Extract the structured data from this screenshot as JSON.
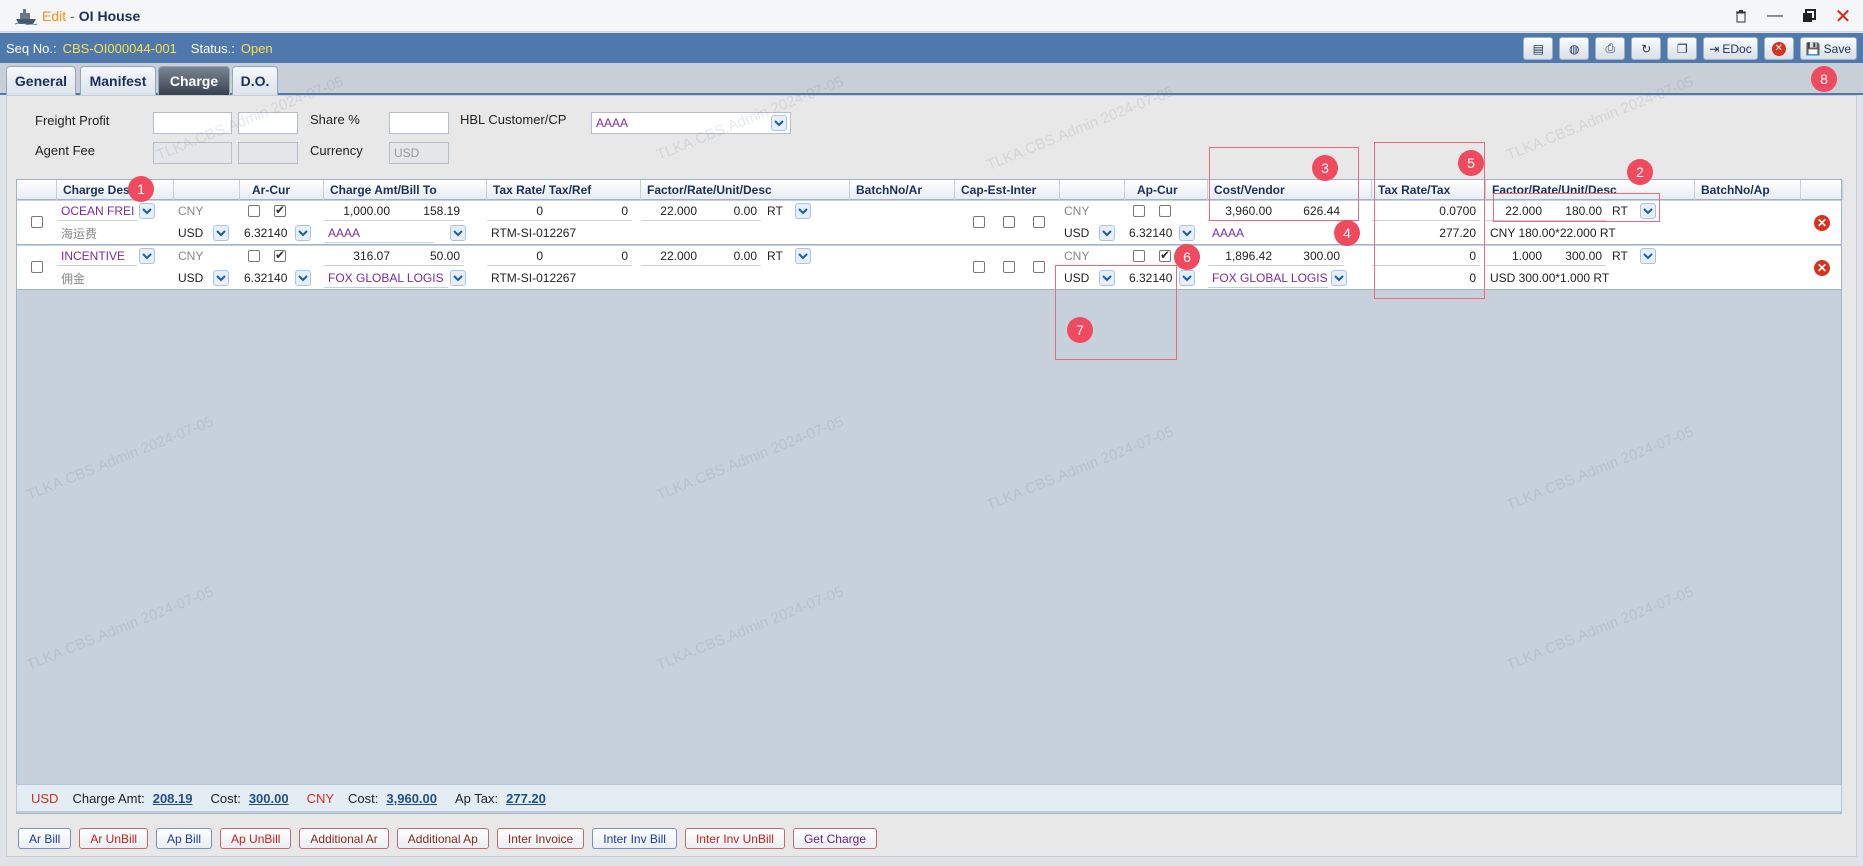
{
  "window": {
    "edit_label": "Edit",
    "separator": "-",
    "title": "OI House"
  },
  "info": {
    "seq_label": "Seq No.:",
    "seq_value": "CBS-OI000044-001",
    "status_label": "Status.:",
    "status_value": "Open"
  },
  "toolbar": {
    "edoc_label": "EDoc",
    "save_label": "Save"
  },
  "tabs": [
    {
      "label": "General"
    },
    {
      "label": "Manifest"
    },
    {
      "label": "Charge"
    },
    {
      "label": "D.O."
    }
  ],
  "form": {
    "freight_profit_label": "Freight Profit",
    "share_label": "Share %",
    "hbl_customer_label": "HBL Customer/CP",
    "hbl_customer_value": "AAAA",
    "agent_fee_label": "Agent Fee",
    "currency_label": "Currency",
    "currency_value": "USD"
  },
  "grid": {
    "headers": [
      "Charge Desc",
      "Ar-Cur",
      "Charge Amt/Bill To",
      "Tax Rate/ Tax/Ref",
      "Factor/Rate/Unit/Desc",
      "BatchNo/Ar",
      "Cap-Est-Inter",
      "Ap-Cur",
      "Cost/Vendor",
      "Tax Rate/Tax",
      "Factor/Rate/Unit/Desc",
      "BatchNo/Ap"
    ],
    "rows": [
      {
        "charge": "OCEAN FREI",
        "charge_cn": "海运费",
        "ar_cur": "CNY",
        "ar_cur2": "USD",
        "ar_rate": "6.32140",
        "amt1": "1,000.00",
        "amt2": "158.19",
        "bill_to": "AAAA",
        "tax1": "0",
        "tax2": "0",
        "tax_ref": "RTM-SI-012267",
        "factor": "22.000",
        "rate": "0.00",
        "unit": "RT",
        "ap_cur": "CNY",
        "ap_cur2": "USD",
        "ap_rate": "6.32140",
        "cost1": "3,960.00",
        "cost2": "626.44",
        "vendor": "AAAA",
        "ap_tax_rate": "0.0700",
        "ap_tax": "277.20",
        "ap_factor": "22.000",
        "ap_rate_val": "180.00",
        "ap_unit": "RT",
        "ap_desc": "CNY 180.00*22.000 RT"
      },
      {
        "charge": "INCENTIVE",
        "charge_cn": "佣金",
        "ar_cur": "CNY",
        "ar_cur2": "USD",
        "ar_rate": "6.32140",
        "amt1": "316.07",
        "amt2": "50.00",
        "bill_to": "FOX GLOBAL LOGIS",
        "tax1": "0",
        "tax2": "0",
        "tax_ref": "RTM-SI-012267",
        "factor": "22.000",
        "rate": "0.00",
        "unit": "RT",
        "ap_cur": "CNY",
        "ap_cur2": "USD",
        "ap_rate": "6.32140",
        "cost1": "1,896.42",
        "cost2": "300.00",
        "vendor": "FOX GLOBAL LOGIS",
        "ap_tax_rate": "0",
        "ap_tax": "0",
        "ap_factor": "1.000",
        "ap_rate_val": "300.00",
        "ap_unit": "RT",
        "ap_desc": "USD 300.00*1.000 RT"
      }
    ]
  },
  "totals": {
    "usd_label": "USD",
    "charge_amt_label": "Charge Amt:",
    "charge_amt": "208.19",
    "cost_label": "Cost:",
    "usd_cost": "300.00",
    "cny_label": "CNY",
    "cny_cost_label": "Cost:",
    "cny_cost": "3,960.00",
    "ap_tax_label": "Ap Tax:",
    "ap_tax": "277.20"
  },
  "buttons": [
    "Ar Bill",
    "Ar UnBill",
    "Ap Bill",
    "Ap UnBill",
    "Additional Ar",
    "Additional Ap",
    "Inter Invoice",
    "Inter Inv Bill",
    "Inter Inv UnBill",
    "Get Charge"
  ],
  "annotations": [
    "1",
    "2",
    "3",
    "4",
    "5",
    "6",
    "7",
    "8"
  ],
  "watermark": "TLKA.CBS.Admin 2024-07-05",
  "colors": {
    "header_blue": "#4f79ad",
    "status_yellow": "#f8e04a",
    "badge_red": "#f04a5e"
  }
}
